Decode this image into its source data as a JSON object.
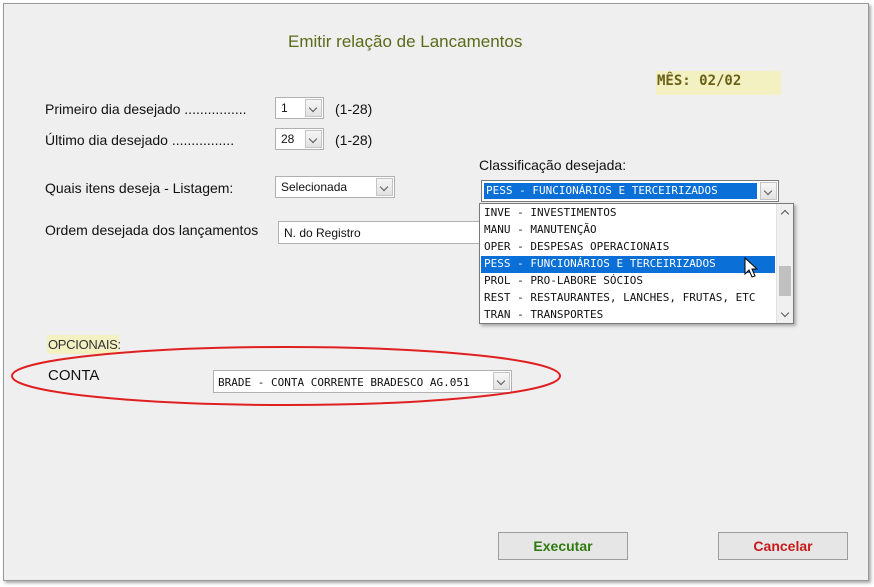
{
  "title": "Emitir relação de Lancamentos",
  "month_label": "MÊS: 02/02",
  "first_day": {
    "label": "Primeiro dia desejado ................",
    "value": "1",
    "range": "(1-28)"
  },
  "last_day": {
    "label": "Último dia desejado ................",
    "value": "28",
    "range": "(1-28)"
  },
  "items": {
    "label": "Quais itens deseja - Listagem:",
    "value": "Selecionada"
  },
  "order": {
    "label": "Ordem desejada dos lançamentos",
    "value": "N. do Registro"
  },
  "classification": {
    "label": "Classificação desejada:",
    "selected": "PESS - FUNCIONÁRIOS E TERCEIRIZADOS",
    "options": [
      "INVE - INVESTIMENTOS",
      "MANU - MANUTENÇÃO",
      "OPER - DESPESAS OPERACIONAIS",
      "PESS - FUNCIONÁRIOS E TERCEIRIZADOS",
      "PROL - PRO-LABORE SÓCIOS",
      "REST - RESTAURANTES, LANCHES, FRUTAS, ETC",
      "TRAN - TRANSPORTES"
    ]
  },
  "optionals": {
    "label": "OPCIONAIS:"
  },
  "conta": {
    "label": "CONTA",
    "value": "BRADE - CONTA CORRENTE BRADESCO AG.051"
  },
  "buttons": {
    "execute": "Executar",
    "cancel": "Cancelar"
  },
  "colors": {
    "accent_title": "#5a6a18",
    "highlight_bg": "#f3f0c2",
    "selection": "#0a6fd6",
    "execute": "#2f7a10",
    "cancel": "#c81a1a",
    "annotation": "#e02020"
  }
}
